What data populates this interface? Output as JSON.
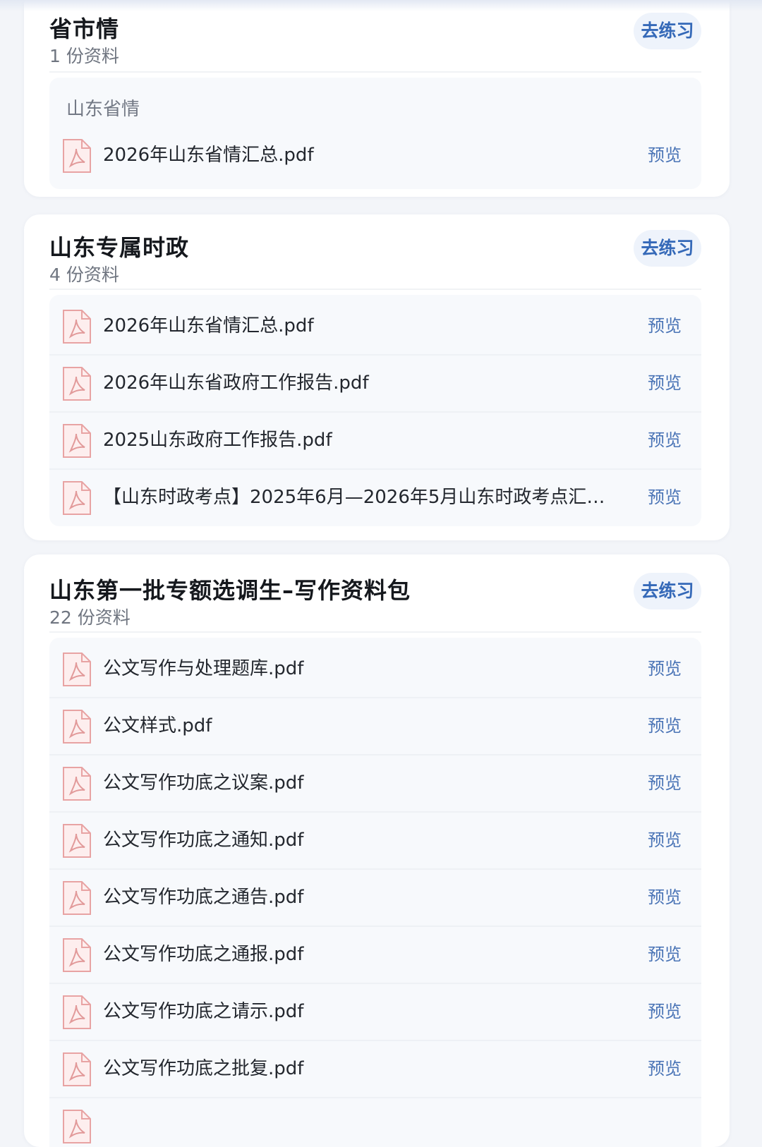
{
  "sections": [
    {
      "title": "省市情",
      "count": "1 份资料",
      "practice_label": "去练习",
      "group_label": "山东省情",
      "files": [
        {
          "name": "2026年山东省情汇总.pdf",
          "action": "预览"
        }
      ]
    },
    {
      "title": "山东专属时政",
      "count": "4 份资料",
      "practice_label": "去练习",
      "files": [
        {
          "name": "2026年山东省情汇总.pdf",
          "action": "预览"
        },
        {
          "name": "2026年山东省政府工作报告.pdf",
          "action": "预览"
        },
        {
          "name": "2025山东政府工作报告.pdf",
          "action": "预览"
        },
        {
          "name": "【山东时政考点】2025年6月—2026年5月山东时政考点汇总...",
          "action": "预览"
        }
      ]
    },
    {
      "title": "山东第一批专额选调生–写作资料包",
      "count": "22 份资料",
      "practice_label": "去练习",
      "files": [
        {
          "name": "公文写作与处理题库.pdf",
          "action": "预览"
        },
        {
          "name": "公文样式.pdf",
          "action": "预览"
        },
        {
          "name": "公文写作功底之议案.pdf",
          "action": "预览"
        },
        {
          "name": "公文写作功底之通知.pdf",
          "action": "预览"
        },
        {
          "name": "公文写作功底之通告.pdf",
          "action": "预览"
        },
        {
          "name": "公文写作功底之通报.pdf",
          "action": "预览"
        },
        {
          "name": "公文写作功底之请示.pdf",
          "action": "预览"
        },
        {
          "name": "公文写作功底之批复.pdf",
          "action": "预览"
        }
      ]
    }
  ],
  "colors": {
    "accent": "#3569b8",
    "pdf_icon": "#e8a3a3"
  },
  "icons": {
    "file": "pdf-file-icon"
  }
}
